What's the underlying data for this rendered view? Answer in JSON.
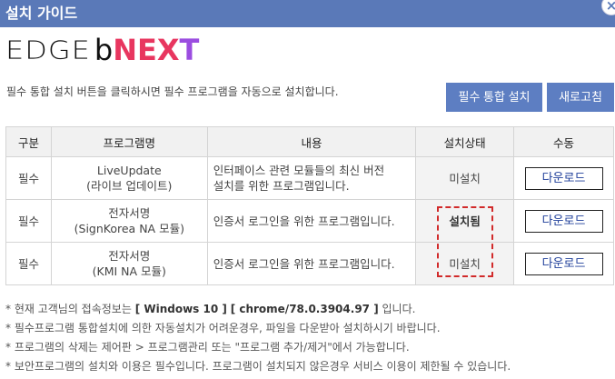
{
  "window": {
    "title": "설치 가이드",
    "close_label": "×"
  },
  "logo": {
    "edge": "EDGE",
    "b": "b",
    "ne": "NE",
    "x": "X",
    "t": "T"
  },
  "description": "필수 통합 설치 버튼을 클릭하시면 필수 프로그램을 자동으로 설치합니다.",
  "buttons": {
    "install_all": "필수 통합 설치",
    "refresh": "새로고침"
  },
  "table": {
    "headers": [
      "구분",
      "프로그램명",
      "내용",
      "설치상태",
      "수동"
    ],
    "rows": [
      {
        "type": "필수",
        "name_line1": "LiveUpdate",
        "name_line2": "(라이브 업데이트)",
        "content_line1": "인터페이스 관련 모듈들의 최신 버전",
        "content_line2": "설치를 위한 프로그램입니다.",
        "status": "미설치",
        "action": "다운로드"
      },
      {
        "type": "필수",
        "name_line1": "전자서명",
        "name_line2": "(SignKorea NA 모듈)",
        "content_line1": "인증서 로그인을 위한 프로그램입니다.",
        "content_line2": "",
        "status": "설치됨",
        "action": "다운로드"
      },
      {
        "type": "필수",
        "name_line1": "전자서명",
        "name_line2": "(KMI NA 모듈)",
        "content_line1": "인증서 로그인을 위한 프로그램입니다.",
        "content_line2": "",
        "status": "미설치",
        "action": "다운로드"
      }
    ]
  },
  "notes": {
    "n1_pre": "* 현재 고객님의 접속정보는 ",
    "n1_os": "[ Windows 10 ]",
    "n1_browser": "[ chrome/78.0.3904.97 ]",
    "n1_post": " 입니다.",
    "n2": "* 필수프로그램 통합설치에 의한 자동설치가 어려운경우, 파일을 다운받아 설치하시기 바랍니다.",
    "n3": "* 프로그램의 삭제는 제어판 > 프로그램관리 또는 \"프로그램 추가/제거\"에서 가능합니다.",
    "n4": "* 보안프로그램의 설치와 이용은 필수입니다. 프로그램이 설치되지 않은경우 서비스 이용이 제한될 수 있습니다."
  }
}
